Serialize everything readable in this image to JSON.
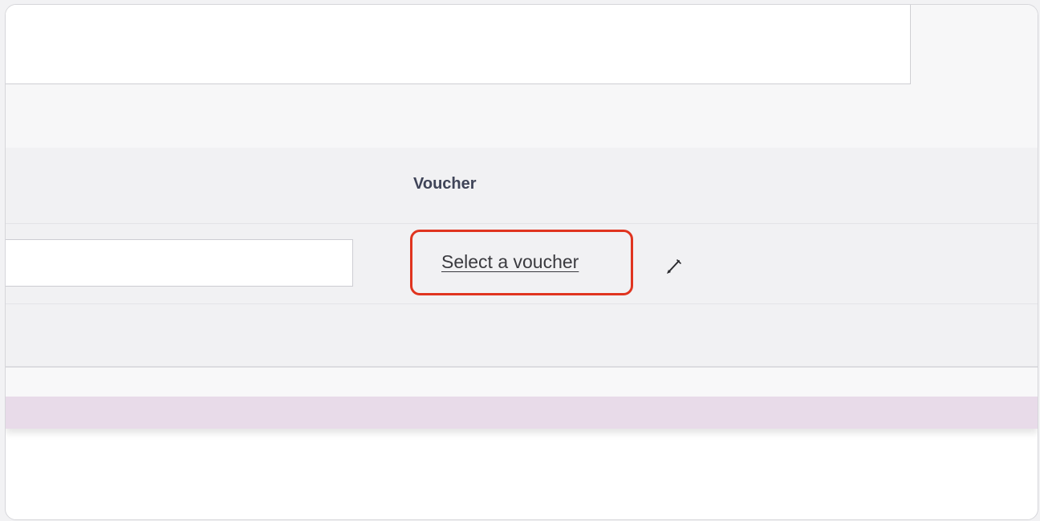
{
  "table": {
    "voucher_column_header": "Voucher",
    "voucher_link_label": "Select a voucher",
    "voucher_input_value": "",
    "edit_icon": "pencil-icon"
  },
  "colors": {
    "highlight": "#e0341f",
    "bottom_bar": "#e8dbe9",
    "panel_background": "#f1f1f3"
  }
}
